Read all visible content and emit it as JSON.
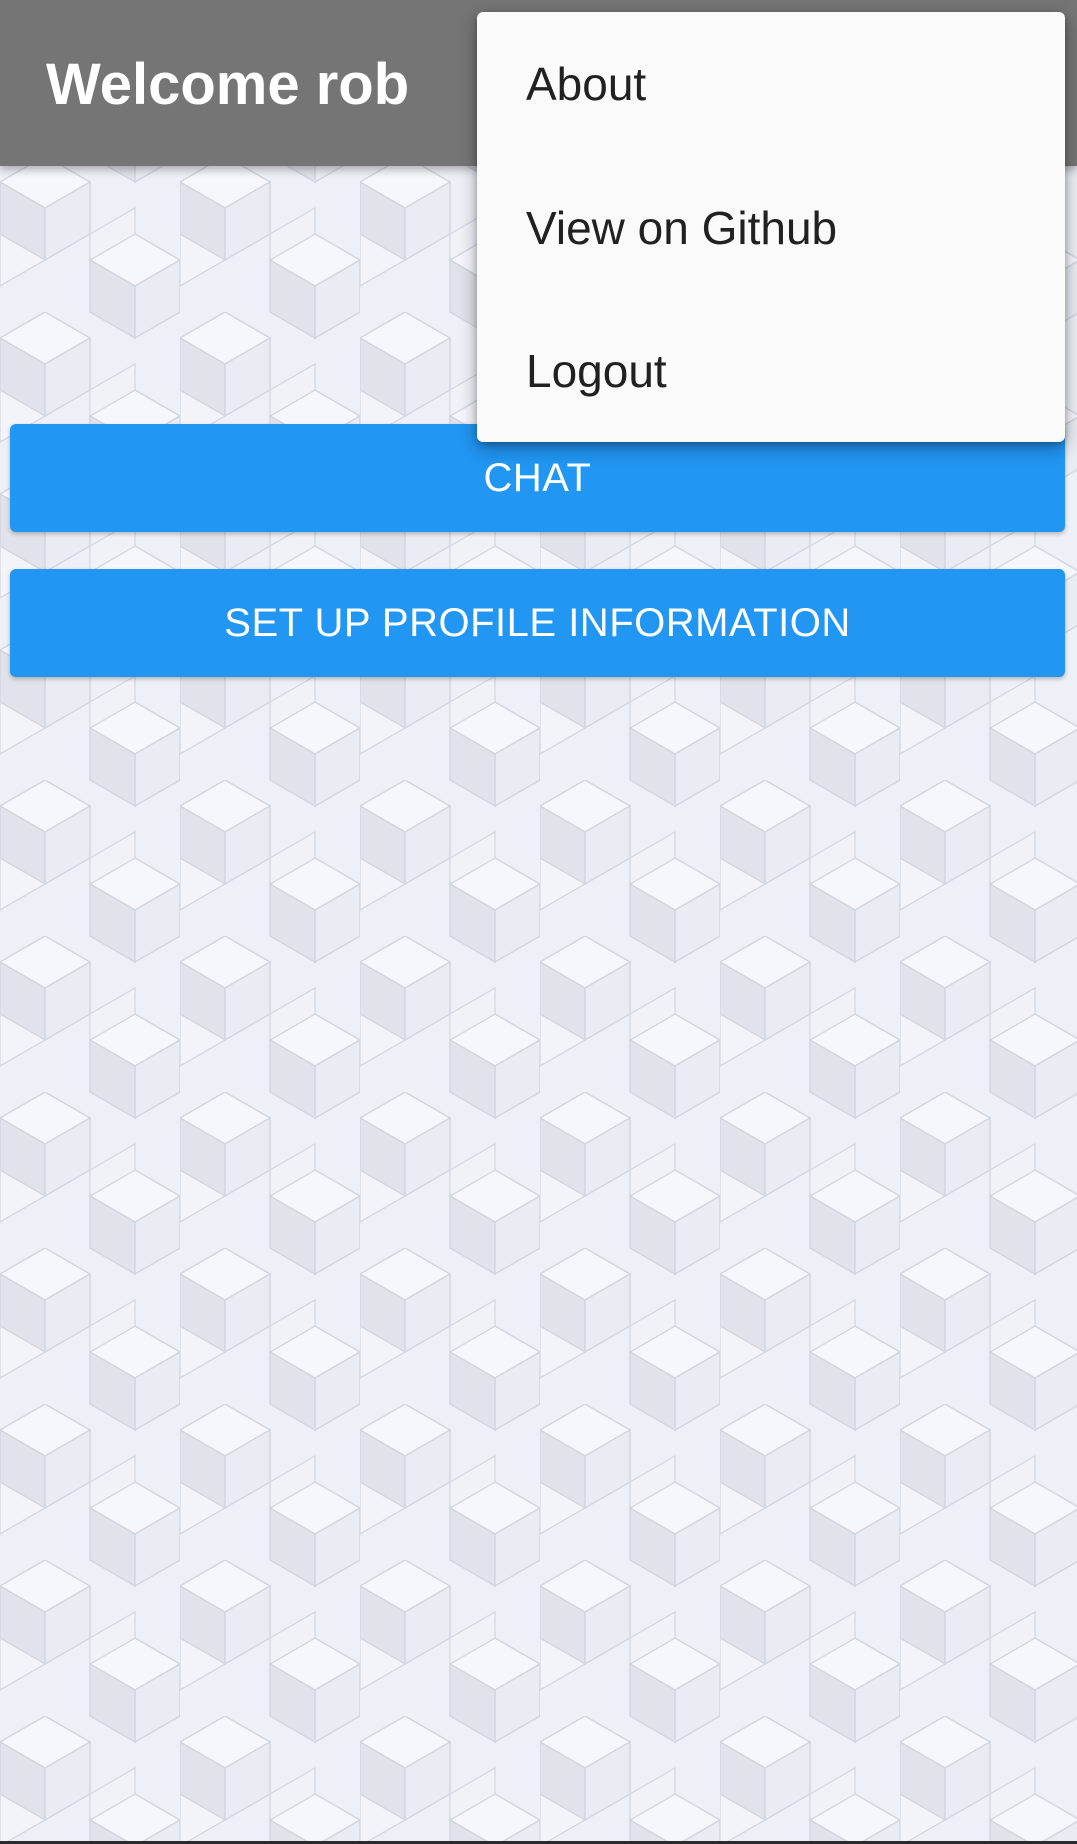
{
  "app_bar": {
    "title": "Welcome rob",
    "color": "#757575"
  },
  "main": {
    "buttons": [
      {
        "label": "CHAT"
      },
      {
        "label": "SET UP PROFILE INFORMATION"
      }
    ],
    "button_color": "#2196f3"
  },
  "overflow_menu": {
    "items": [
      {
        "label": "About"
      },
      {
        "label": "View on Github"
      },
      {
        "label": "Logout"
      }
    ]
  },
  "background": {
    "pattern": "cube-tessellation",
    "color": "#eef0f7"
  }
}
